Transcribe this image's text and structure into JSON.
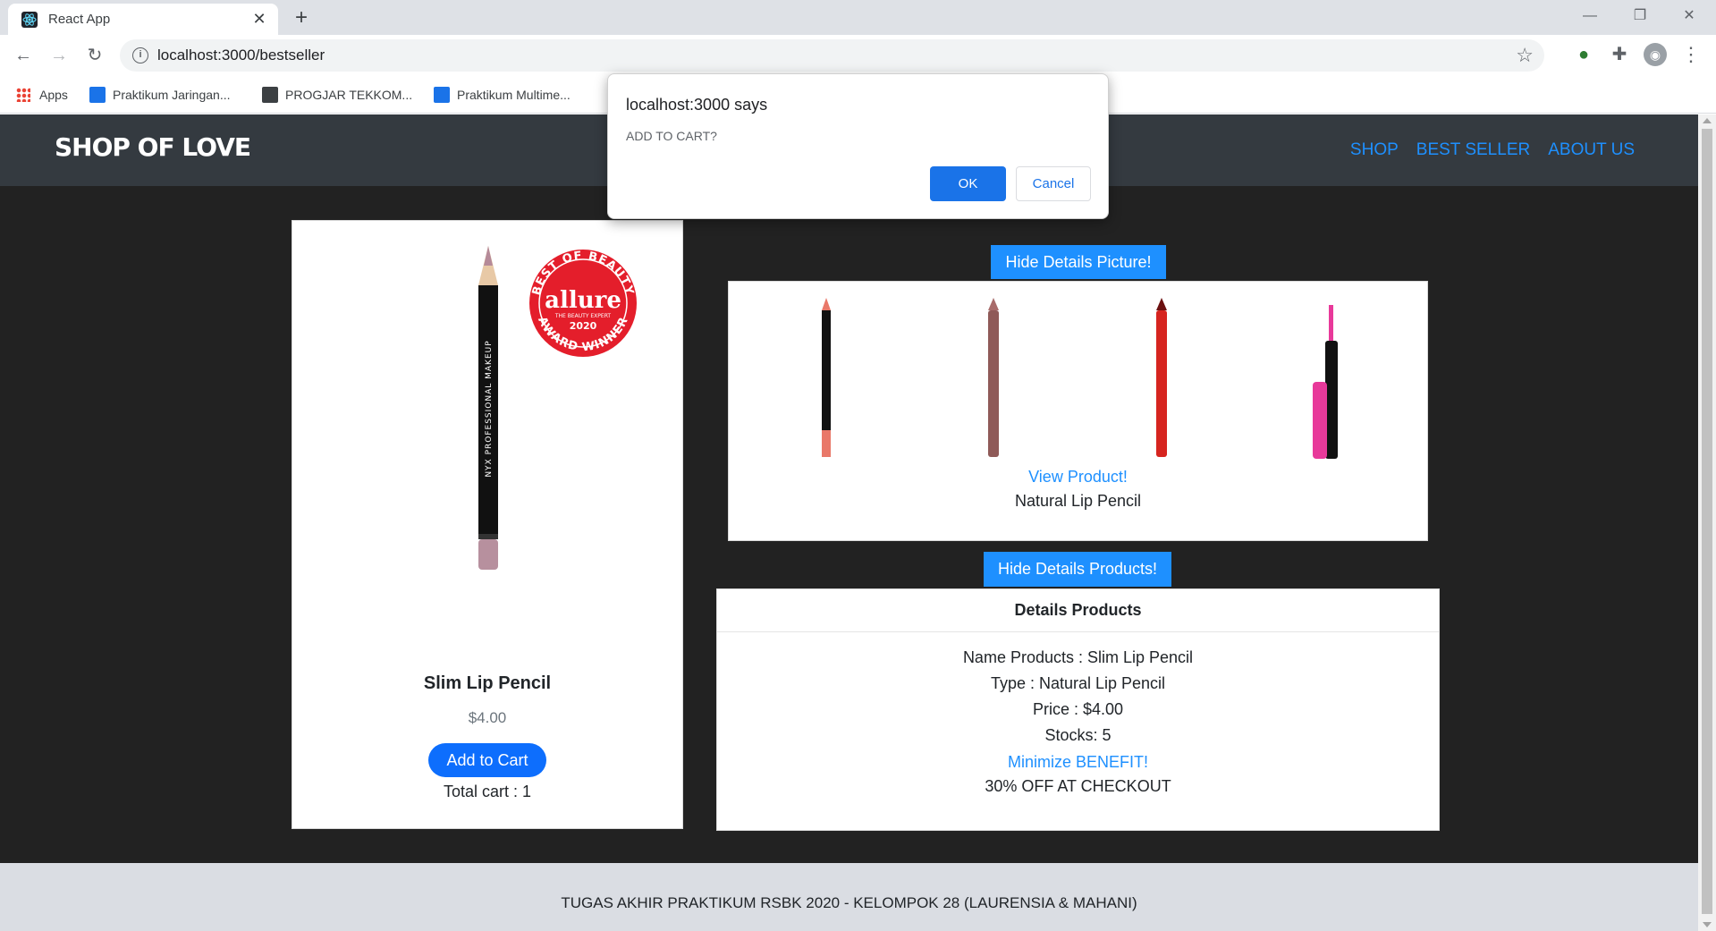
{
  "browser": {
    "tab_title": "React App",
    "tab_close": "✕",
    "new_tab": "+",
    "url": "localhost:3000/bestseller",
    "bookmarks": [
      {
        "label": "Apps"
      },
      {
        "label": "Praktikum Jaringan..."
      },
      {
        "label": "PROGJAR TEKKOM..."
      },
      {
        "label": "Praktikum Multime..."
      }
    ]
  },
  "navbar": {
    "brand": "SHOP OF LOVE",
    "links": [
      "SHOP",
      "BEST SELLER",
      "ABOUT US"
    ]
  },
  "product_card": {
    "title": "Slim Lip Pencil",
    "price": "$4.00",
    "add_button": "Add to Cart",
    "total_cart": "Total cart : 1",
    "badge": {
      "top_text": "BEST OF BEAUTY",
      "brand": "allure",
      "sub": "THE BEAUTY EXPERT",
      "year": "2020",
      "bottom_text": "AWARD WINNER",
      "color": "#e41e2b"
    },
    "pencil_text": "NYX PROFESSIONAL MAKEUP"
  },
  "picture_panel": {
    "toggle_button": "Hide Details Picture!",
    "view_link": "View Product!",
    "type_label": "Natural Lip Pencil",
    "swatches": [
      "#e97869",
      "#a86b6a",
      "#d6241f",
      "#e8399a"
    ]
  },
  "details_panel": {
    "toggle_button": "Hide Details Products!",
    "header": "Details Products",
    "name": "Name Products : Slim Lip Pencil",
    "type": "Type : Natural Lip Pencil",
    "price": "Price : $4.00",
    "stocks": "Stocks: 5",
    "benefit_link": "Minimize BENEFIT!",
    "benefit": "30% OFF AT CHECKOUT"
  },
  "footer": {
    "text": "TUGAS AKHIR PRAKTIKUM RSBK 2020 - KELOMPOK 28 (LAURENSIA & MAHANI)"
  },
  "dialog": {
    "title": "localhost:3000 says",
    "message": "ADD TO CART?",
    "ok": "OK",
    "cancel": "Cancel"
  },
  "colors": {
    "page_bg": "#222222",
    "navbar_bg": "#343a40",
    "link": "#1e90ff",
    "primary_button": "#0d6efd",
    "dialog_button": "#1a73e8"
  }
}
